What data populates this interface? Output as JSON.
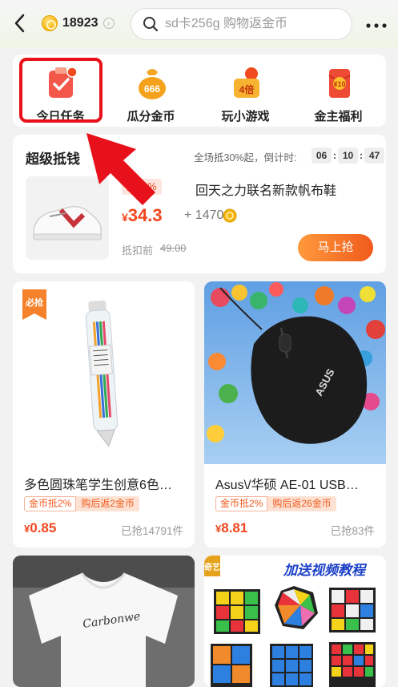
{
  "header": {
    "coin_count": "18923",
    "search_placeholder": "sd卡256g 购物返金币"
  },
  "quick_entries": [
    {
      "label": "今日任务",
      "icon": "task-clipboard-icon"
    },
    {
      "label": "瓜分金币",
      "icon": "money-bag-666-icon",
      "icon_text": "666"
    },
    {
      "label": "玩小游戏",
      "icon": "game-4x-icon",
      "icon_text": "4倍"
    },
    {
      "label": "金主福利",
      "icon": "red-envelope-icon",
      "icon_text": "¥10"
    }
  ],
  "deal": {
    "title": "超级抵钱",
    "subtitle": "全场抵30%起，倒计时:",
    "timer": {
      "h": "06",
      "m": "10",
      "s": "47"
    },
    "tag": "抵30%",
    "name": "回天之力联名新款帆布鞋",
    "price_symbol": "¥",
    "price": "34.3",
    "plus_coins": "+ 1470",
    "before_label": "抵扣前",
    "before_price": "49.00",
    "buy_label": "马上抢"
  },
  "products": [
    {
      "name": "多色圆珠笔学生创意6色…",
      "badge1": "金币抵2%",
      "badge2": "购后返2金币",
      "price_symbol": "¥",
      "price": "0.85",
      "sold": "已抢14791件",
      "tag": "必抢"
    },
    {
      "name": "Asus\\/华硕 AE-01 USB…",
      "badge1": "金币抵2%",
      "badge2": "购后返26金币",
      "price_symbol": "¥",
      "price": "8.81",
      "sold": "已抢83件",
      "logo_text": "ASUS"
    },
    {
      "shirt_text": "Carbonwe"
    },
    {
      "tag": "奇艺",
      "banner": "加送视频教程"
    }
  ],
  "colors": {
    "accent": "#f0471e",
    "highlight": "#e8101a"
  }
}
